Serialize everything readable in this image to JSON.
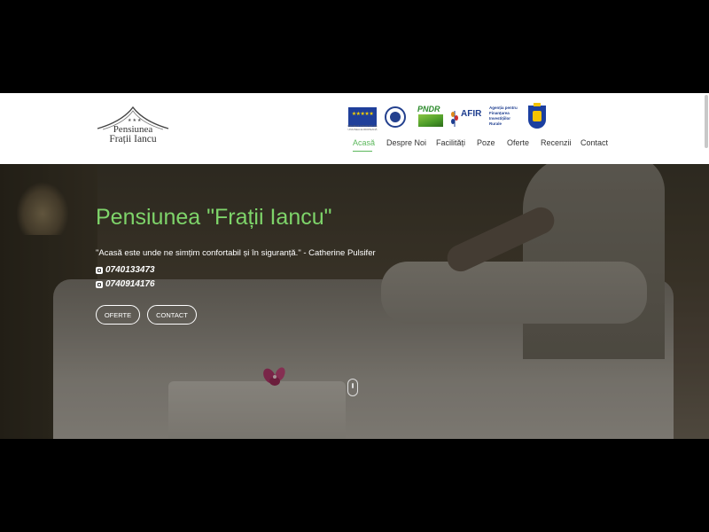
{
  "logo": {
    "line1": "Pensiunea",
    "line2": "Frații Iancu",
    "stars": "★★★"
  },
  "sponsors": {
    "eu": {
      "icon": "eu-flag-icon",
      "caption": "PROIECT FINANȚAT DE UNIUNEA EUROPEANĂ"
    },
    "gov": {
      "icon": "government-seal-icon"
    },
    "pndr": {
      "label": "PNDR",
      "icon": "pndr-logo-icon"
    },
    "afir": {
      "name": "AFIR",
      "desc": "Agenția pentru Finanțarea Investițiilor Rurale"
    },
    "ro": {
      "icon": "romania-coat-of-arms-icon"
    }
  },
  "nav": {
    "items": [
      "Acasă",
      "Despre Noi",
      "Facilități",
      "Poze",
      "Oferte",
      "Recenzii",
      "Contact"
    ],
    "active_color": "#5cb85c"
  },
  "hero": {
    "title": "Pensiunea \"Frații Iancu\"",
    "quote": "\"Acasă este unde ne simțim confortabil și în siguranță.\" - Catherine Pulsifer",
    "phone1": "0740133473",
    "phone2": "0740914176",
    "btn_offers": "OFERTE",
    "btn_contact": "CONTACT",
    "title_color": "#7ed46a"
  }
}
